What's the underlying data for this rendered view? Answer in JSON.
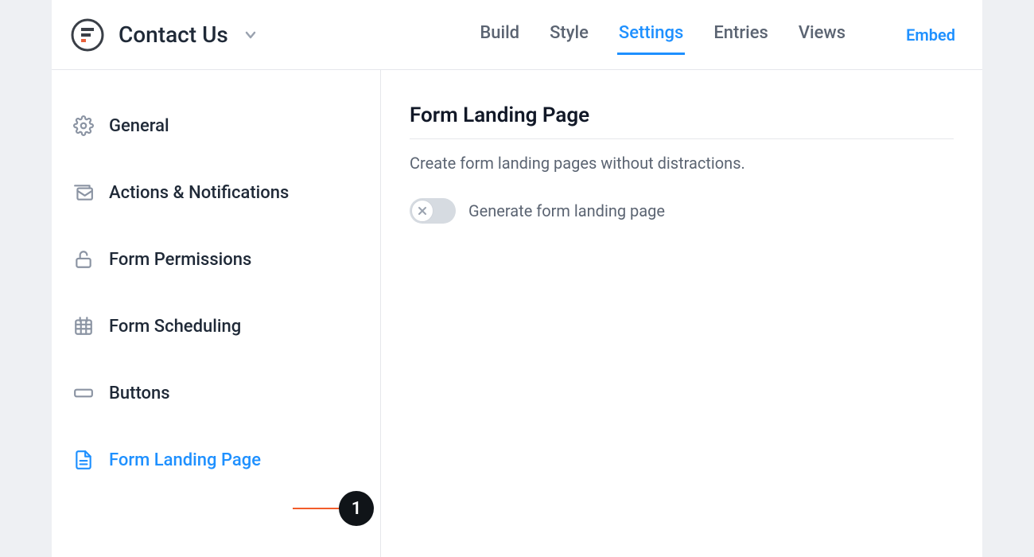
{
  "header": {
    "title": "Contact Us",
    "tabs": [
      {
        "label": "Build",
        "active": false
      },
      {
        "label": "Style",
        "active": false
      },
      {
        "label": "Settings",
        "active": true
      },
      {
        "label": "Entries",
        "active": false
      },
      {
        "label": "Views",
        "active": false
      }
    ],
    "embed_label": "Embed"
  },
  "sidebar": {
    "items": [
      {
        "label": "General",
        "icon": "gear-icon",
        "active": false
      },
      {
        "label": "Actions & Notifications",
        "icon": "mail-icon",
        "active": false
      },
      {
        "label": "Form Permissions",
        "icon": "lock-icon",
        "active": false
      },
      {
        "label": "Form Scheduling",
        "icon": "calendar-icon",
        "active": false
      },
      {
        "label": "Buttons",
        "icon": "button-icon",
        "active": false
      },
      {
        "label": "Form Landing Page",
        "icon": "page-icon",
        "active": true
      }
    ]
  },
  "main": {
    "section_title": "Form Landing Page",
    "section_desc": "Create form landing pages without distractions.",
    "toggle_label": "Generate form landing page",
    "toggle_on": false
  },
  "annotation": {
    "number": "1"
  }
}
